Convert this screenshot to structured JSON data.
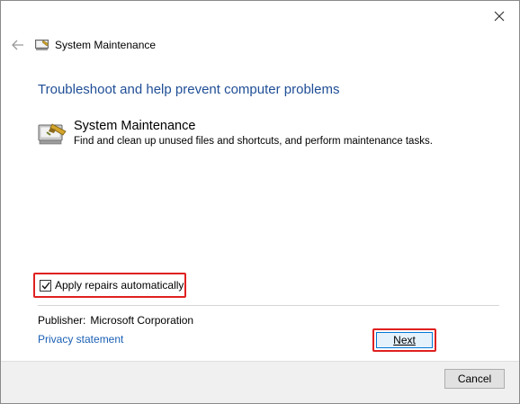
{
  "window": {
    "title": "System Maintenance",
    "close_icon": "close-icon",
    "back_icon": "back-arrow-icon"
  },
  "main": {
    "heading": "Troubleshoot and help prevent computer problems",
    "tool": {
      "name": "System Maintenance",
      "description": "Find and clean up unused files and shortcuts, and perform maintenance tasks.",
      "icon": "system-maintenance-icon"
    },
    "apply_repairs": {
      "label": "Apply repairs automatically",
      "checked": true
    },
    "publisher_label": "Publisher:",
    "publisher_value": "Microsoft Corporation",
    "privacy_link": "Privacy statement"
  },
  "footer": {
    "next_label": "Next",
    "cancel_label": "Cancel"
  },
  "colors": {
    "heading": "#1f4e96",
    "link": "#1a5fb4",
    "highlight": "#e02020",
    "footer_bg": "#f0f0f0"
  }
}
